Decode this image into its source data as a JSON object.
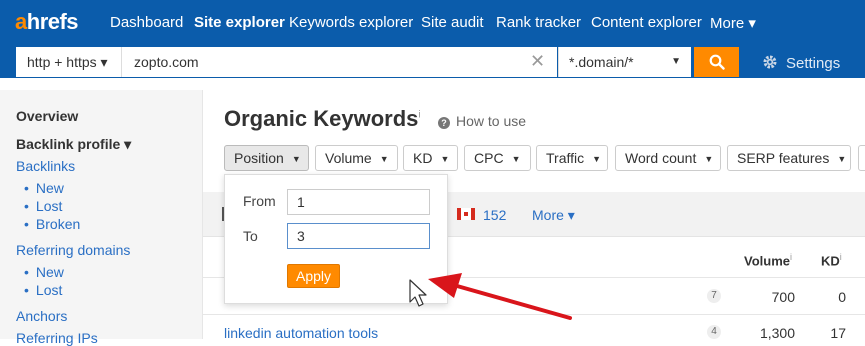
{
  "logo": {
    "a": "a",
    "rest": "hrefs"
  },
  "nav": {
    "items": [
      "Dashboard",
      "Site explorer",
      "Keywords explorer",
      "Site audit",
      "Rank tracker",
      "Content explorer",
      "More ▾"
    ],
    "active": "Site explorer"
  },
  "search": {
    "protocol": "http + https ▾",
    "url": "zopto.com",
    "mode": "*.domain/*",
    "settings_label": "Settings"
  },
  "sidebar": {
    "overview": "Overview",
    "backlink_profile": "Backlink profile ▾",
    "backlinks": "Backlinks",
    "backlinks_sub": [
      "New",
      "Lost",
      "Broken"
    ],
    "referring_domains": "Referring domains",
    "referring_sub": [
      "New",
      "Lost"
    ],
    "anchors": "Anchors",
    "referring_ips": "Referring IPs"
  },
  "page": {
    "title": "Organic Keywords",
    "title_info": "i",
    "how_to_use": "How to use"
  },
  "filters": [
    "Position",
    "Volume",
    "KD",
    "CPC",
    "Traffic",
    "Word count",
    "SERP features"
  ],
  "band": {
    "flag_count": "152",
    "more": "More ▾"
  },
  "table": {
    "headers": {
      "volume": "Volume",
      "kd": "KD",
      "info": "i"
    },
    "rows": [
      {
        "keyword": "",
        "position": "7",
        "volume": "700",
        "kd": "0"
      },
      {
        "keyword": "linkedin automation tools",
        "position": "4",
        "volume": "1,300",
        "kd": "17"
      }
    ]
  },
  "position_popup": {
    "from_label": "From",
    "from_value": "1",
    "to_label": "To",
    "to_value": "3",
    "apply_label": "Apply"
  },
  "colors": {
    "nav_bg": "#0b5cab",
    "accent": "#ff8a00",
    "link": "#2a6fc4",
    "arrow": "#d9151b"
  }
}
